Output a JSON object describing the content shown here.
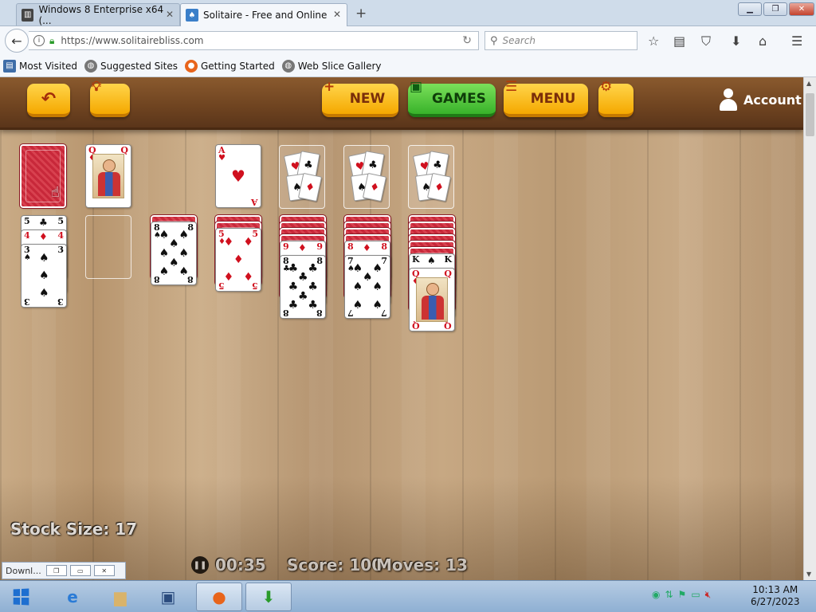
{
  "browser": {
    "tabs": [
      {
        "label": "Windows 8 Enterprise x64 (...",
        "active": false
      },
      {
        "label": "Solitaire - Free and Online",
        "active": true
      }
    ],
    "url": "https://www.solitairebliss.com",
    "search_placeholder": "Search",
    "bookmarks": [
      "Most Visited",
      "Suggested Sites",
      "Getting Started",
      "Web Slice Gallery"
    ]
  },
  "game": {
    "buttons": {
      "new": "NEW",
      "games": "GAMES",
      "menu": "MENU",
      "account": "Account"
    },
    "status": {
      "stock_size": "Stock Size: 17",
      "timer": "00:35",
      "score": "Score: 100",
      "moves": "Moves: 13"
    },
    "waste_card": {
      "rank": "Q",
      "suit": "♦",
      "color": "red"
    },
    "foundations": [
      {
        "rank": "A",
        "suit": "♥",
        "color": "red"
      }
    ],
    "tableau": [
      {
        "hidden": 0,
        "visible": [
          {
            "rank": "5",
            "suit": "♣"
          },
          {
            "rank": "4",
            "suit": "♦"
          },
          {
            "rank": "3",
            "suit": "♠"
          }
        ]
      },
      {
        "hidden": 0,
        "visible": []
      },
      {
        "hidden": 1,
        "visible": [
          {
            "rank": "8",
            "suit": "♠"
          }
        ]
      },
      {
        "hidden": 2,
        "visible": [
          {
            "rank": "5",
            "suit": "♦"
          }
        ]
      },
      {
        "hidden": 4,
        "visible": [
          {
            "rank": "9",
            "suit": "♦"
          },
          {
            "rank": "8",
            "suit": "♣"
          }
        ]
      },
      {
        "hidden": 4,
        "visible": [
          {
            "rank": "8",
            "suit": "♦"
          },
          {
            "rank": "7",
            "suit": "♠"
          }
        ]
      },
      {
        "hidden": 6,
        "visible": [
          {
            "rank": "K",
            "suit": "♠"
          },
          {
            "rank": "Q",
            "suit": "♦"
          }
        ]
      }
    ]
  },
  "downloads": {
    "label": "Downl..."
  },
  "taskbar": {
    "clock_time": "10:13 AM",
    "clock_date": "6/27/2023"
  },
  "icons": [
    "back-icon",
    "info-icon",
    "lock-icon",
    "reload-icon",
    "search-icon",
    "star-icon",
    "reading-list-icon",
    "pocket-icon",
    "download-icon",
    "home-icon",
    "menu-icon",
    "undo-icon",
    "hint-icon",
    "settings-icon",
    "user-icon",
    "pause-icon"
  ]
}
